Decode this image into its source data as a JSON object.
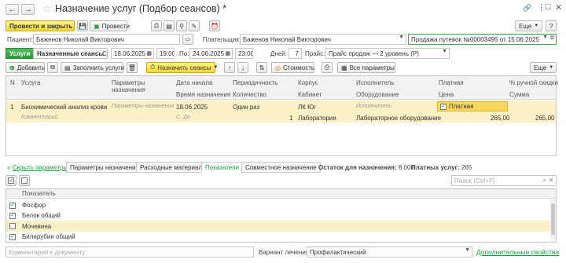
{
  "window": {
    "title": "Назначение услуг (Подбор сеансов) *"
  },
  "toolbar": {
    "post_close": "Провести и закрыть",
    "post": "Провести",
    "more": "Еще",
    "help": "?"
  },
  "header": {
    "patient_label": "Пациент:",
    "patient_value": "Баженов Николай Викторович",
    "payer_label": "Плательщик:",
    "payer_value": "Баженов Николай Викторович",
    "sale_doc": "Продажа путевок №00003495 от 15.06.2025"
  },
  "filters": {
    "tab_services": "Услуги",
    "tab_sessions": "Назначенные сеансы",
    "from_label": "С:",
    "from_date": "18.06.2025",
    "from_time": "19:00",
    "to_label": "По:",
    "to_date": "24.06.2025",
    "to_time": "23:00",
    "days_label": "Дней:",
    "days_value": "7",
    "price_label": "Прайс:",
    "price_value": "Прайс продаж — 2 уровень (Р)"
  },
  "actions": {
    "add": "Добавить",
    "fill_services": "Заполнить услуги",
    "assign_sessions": "Назначить сеансы",
    "cost": "Стоимость",
    "all_params": "Все параметры",
    "more": "Еще"
  },
  "table": {
    "headers": {
      "n": "N",
      "service": "Услуга",
      "params": "Параметры назначения",
      "start_date": "Дата начала",
      "start_time": "Время назначения",
      "periodicity": "Периодичность",
      "quantity": "Количество",
      "building": "Корпус",
      "cabinet": "Кабинет",
      "executor": "Исполнитель",
      "equipment": "Оборудование",
      "paid": "Платная",
      "price": "Цена",
      "discount": "% ручной скидки",
      "sum": "Сумма"
    },
    "row": {
      "n": "1",
      "service": "Биохимический анализ крови",
      "params": "Параметры назначения",
      "start_date": "18.06.2025",
      "start_time": "С. До",
      "periodicity": "Один раз",
      "quantity": "1",
      "comment": "Комментарий",
      "building": "ЛК Юг",
      "cabinet": "Лаборатория",
      "executor": "Исполнитель",
      "equipment": "Лабораторное оборудование",
      "paid": "Платная",
      "price": "265,00",
      "sum": "265,00"
    }
  },
  "bottom": {
    "hide_params": "Скрыть параметры",
    "tabs": [
      "Параметры назначения",
      "Расходные материалы",
      "Показатели",
      "Совместное назначение"
    ],
    "remaining_label": "Остаток для назначения:",
    "remaining_value": "8 000",
    "paid_label": "Платных услуг:",
    "paid_value": "265",
    "search_placeholder": "Поиск (Ctrl+F)",
    "indicator_header": "Показатель",
    "indicators": [
      {
        "name": "Фосфор",
        "checked": true
      },
      {
        "name": "Белок общий",
        "checked": true
      },
      {
        "name": "Мочевина",
        "checked": false
      },
      {
        "name": "Билирубин общий",
        "checked": true
      }
    ]
  },
  "footer": {
    "comment_placeholder": "Комментарий к документу",
    "treatment_label": "Вариант лечения:",
    "treatment_value": "Профилактический",
    "extra_props": "Дополнительные свойства"
  },
  "colors": {
    "accent_green": "#1e9e3a",
    "highlight_row": "#fbf1c6",
    "yellow_button": "#f5d931"
  }
}
